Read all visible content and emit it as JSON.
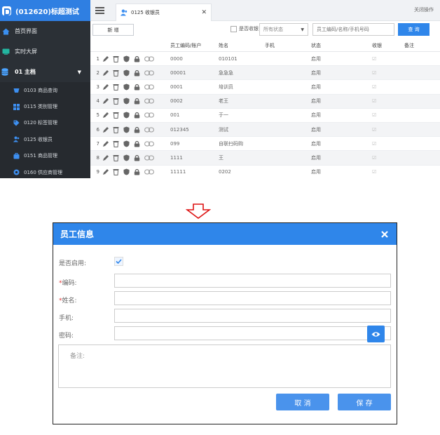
{
  "sidebar": {
    "brand": "(012620)标超测试",
    "top_items": [
      {
        "label": "首页界面",
        "icon": "home-icon"
      },
      {
        "label": "实时大屏",
        "icon": "dashboard-icon"
      }
    ],
    "group": {
      "label": "01 主档",
      "icon": "database-icon"
    },
    "sub_items": [
      {
        "label": "0103 商品查询",
        "icon": "product-search-icon"
      },
      {
        "label": "0115 类别管理",
        "icon": "category-icon"
      },
      {
        "label": "0120 标签管理",
        "icon": "tag-icon"
      },
      {
        "label": "0125 收银员",
        "icon": "cashier-icon"
      },
      {
        "label": "0151 商品管理",
        "icon": "goods-icon"
      },
      {
        "label": "0160 供应商管理",
        "icon": "supplier-icon"
      }
    ]
  },
  "tabbar": {
    "tab_label": "0125 收银员",
    "close_ops": "关闭操作"
  },
  "toolbar": {
    "new_label": "新 增",
    "cashier_filter_label": "是否收银",
    "status_placeholder": "所有状态",
    "search_placeholder": "员工编码/名称/手机号码",
    "search_label": "查 询"
  },
  "table": {
    "headers": {
      "code": "员工编码/账户",
      "name": "姓名",
      "phone": "手机",
      "status": "状态",
      "cashier": "收银",
      "note": "备注"
    },
    "rows": [
      {
        "index": "1",
        "code": "0000",
        "name": "010101",
        "phone": "",
        "status": "启用",
        "cashier": "☑",
        "note": ""
      },
      {
        "index": "2",
        "code": "00001",
        "name": "急急急",
        "phone": "",
        "status": "启用",
        "cashier": "☑",
        "note": ""
      },
      {
        "index": "3",
        "code": "0001",
        "name": "培训员",
        "phone": "",
        "status": "启用",
        "cashier": "☑",
        "note": ""
      },
      {
        "index": "4",
        "code": "0002",
        "name": "老王",
        "phone": "",
        "status": "启用",
        "cashier": "☑",
        "note": ""
      },
      {
        "index": "5",
        "code": "001",
        "name": "于一",
        "phone": "",
        "status": "启用",
        "cashier": "☑",
        "note": ""
      },
      {
        "index": "6",
        "code": "012345",
        "name": "测试",
        "phone": "",
        "status": "启用",
        "cashier": "☑",
        "note": ""
      },
      {
        "index": "7",
        "code": "099",
        "name": "自联扫码购",
        "phone": "",
        "status": "启用",
        "cashier": "☑",
        "note": ""
      },
      {
        "index": "8",
        "code": "1111",
        "name": "王",
        "phone": "",
        "status": "启用",
        "cashier": "☑",
        "note": ""
      },
      {
        "index": "9",
        "code": "11111",
        "name": "0202",
        "phone": "",
        "status": "启用",
        "cashier": "☑",
        "note": ""
      }
    ]
  },
  "dialog": {
    "title": "员工信息",
    "enable_label": "是否启用:",
    "code_label": "编码:",
    "name_label": "姓名:",
    "phone_label": "手机:",
    "password_label": "密码:",
    "required_mark": "*",
    "remark_placeholder": "备注:",
    "cancel_label": "取 消",
    "save_label": "保 存"
  },
  "colors": {
    "accent": "#2f86ea",
    "sidebar_bg": "#2b3036",
    "brand_bg": "#2f7fe2",
    "required": "#e23b3b"
  }
}
